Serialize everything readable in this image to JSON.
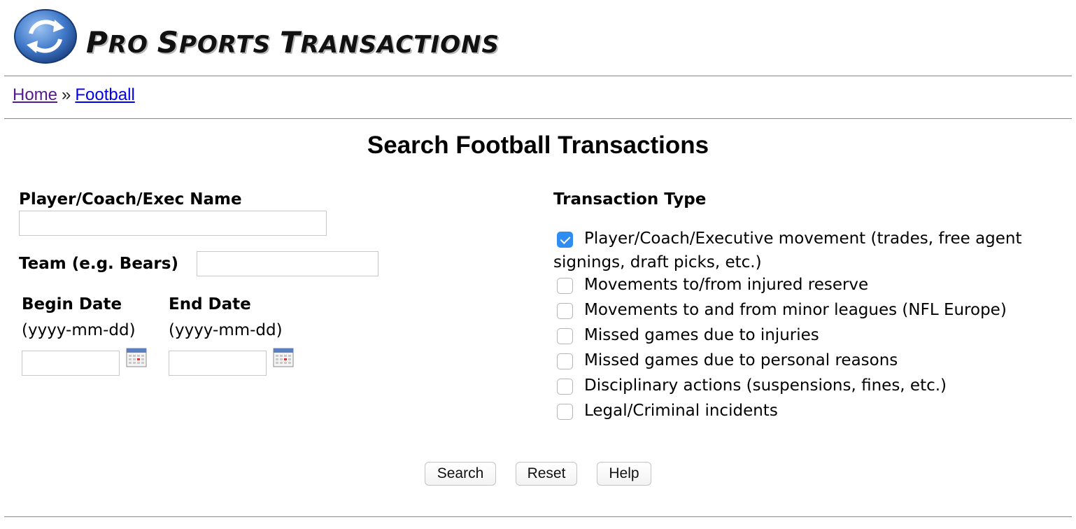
{
  "header": {
    "logo_text_p": "P",
    "logo_text_ro": "RO ",
    "logo_text_s": "S",
    "logo_text_ports": "PORTS ",
    "logo_text_t": "T",
    "logo_text_ransactions": "RANSACTIONS",
    "logo_icon": "circular-arrows-icon"
  },
  "breadcrumb": {
    "home": "Home",
    "separator": "»",
    "current": "Football"
  },
  "page_title": "Search Football Transactions",
  "form": {
    "name_label": "Player/Coach/Exec Name",
    "name_value": "",
    "team_label": "Team (e.g. Bears)",
    "team_value": "",
    "begin_date_label": "Begin Date",
    "begin_date_hint": "(yyyy-mm-dd)",
    "begin_date_value": "",
    "end_date_label": "End Date",
    "end_date_hint": "(yyyy-mm-dd)",
    "end_date_value": "",
    "calendar_icon": "calendar-icon"
  },
  "transaction_type": {
    "label": "Transaction Type",
    "options": [
      {
        "line1": "Player/Coach/Executive movement (trades, free agent",
        "line2": "signings, draft picks, etc.)",
        "checked": true
      },
      {
        "line1": "Movements to/from injured reserve",
        "checked": false
      },
      {
        "line1": "Movements to and from minor leagues (NFL Europe)",
        "checked": false
      },
      {
        "line1": "Missed games due to injuries",
        "checked": false
      },
      {
        "line1": "Missed games due to personal reasons",
        "checked": false
      },
      {
        "line1": "Disciplinary actions (suspensions, fines, etc.)",
        "checked": false
      },
      {
        "line1": "Legal/Criminal incidents",
        "checked": false
      }
    ]
  },
  "buttons": {
    "search": "Search",
    "reset": "Reset",
    "help": "Help"
  },
  "colors": {
    "link": "#0000ee",
    "visited_link": "#551a8b",
    "checkbox_checked": "#2f8df2"
  }
}
